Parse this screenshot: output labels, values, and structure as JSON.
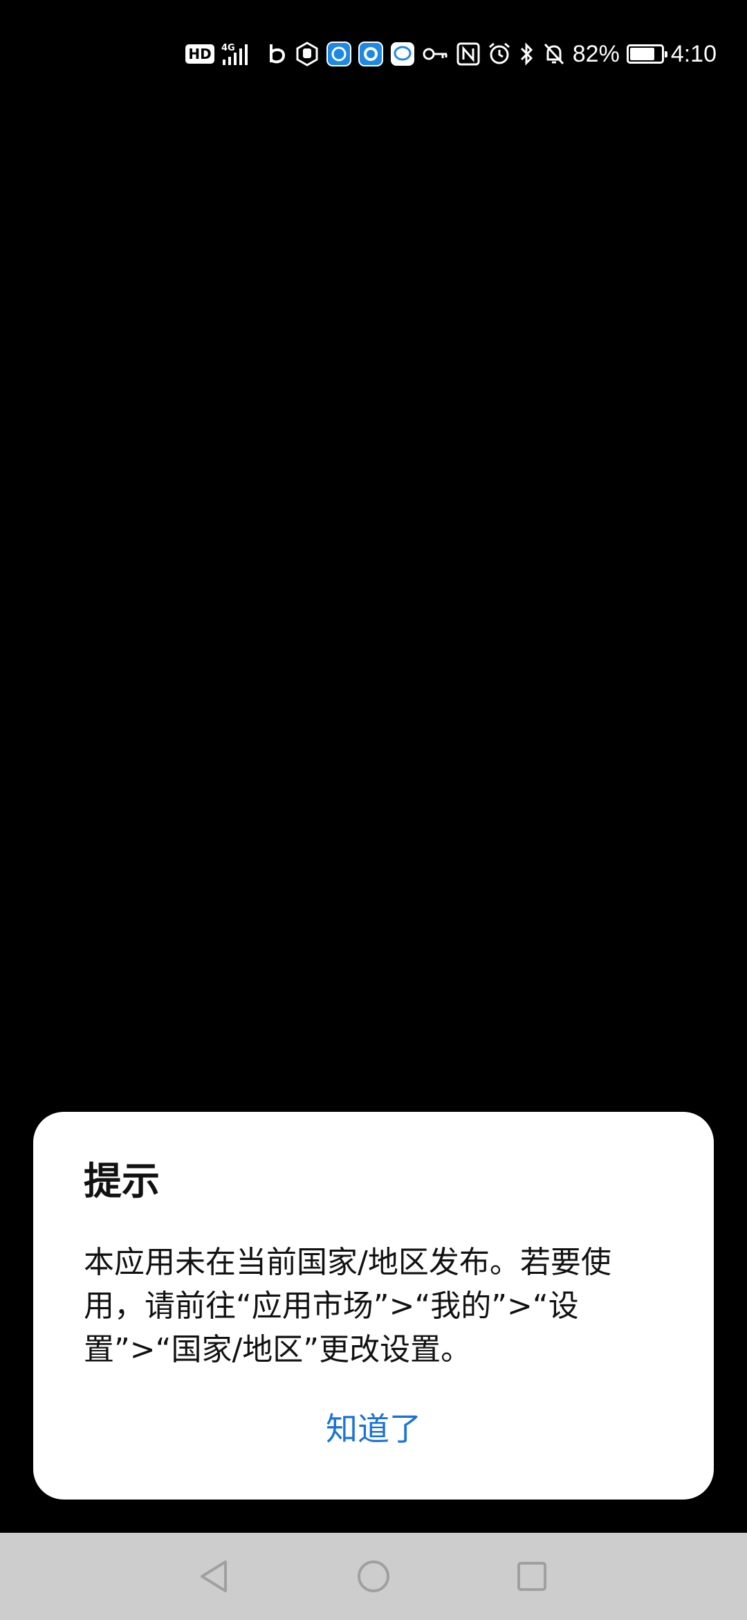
{
  "status_bar": {
    "hd_label": "HD",
    "network_label": "4G",
    "battery_percent": "82%",
    "battery_level": 0.82,
    "time": "4:10",
    "icons": [
      "hd-icon",
      "signal-4g-icon",
      "b-app-icon",
      "hand-app-icon",
      "blue-app-icon",
      "browser-app-icon",
      "chat-app-icon",
      "key-icon",
      "nfc-icon",
      "alarm-icon",
      "bluetooth-icon",
      "mute-icon",
      "battery-icon"
    ]
  },
  "dialog": {
    "title": "提示",
    "message": "本应用未在当前国家/地区发布。若要使用，请前往“应用市场”>“我的”>“设置”>“国家/地区”更改设置。",
    "confirm_label": "知道了"
  },
  "nav_bar": {
    "buttons": [
      "back-icon",
      "home-icon",
      "recents-icon"
    ]
  },
  "colors": {
    "background": "#000000",
    "dialog_bg": "#ffffff",
    "accent": "#1a73d9",
    "nav_bar_bg": "#cdcdcd"
  }
}
